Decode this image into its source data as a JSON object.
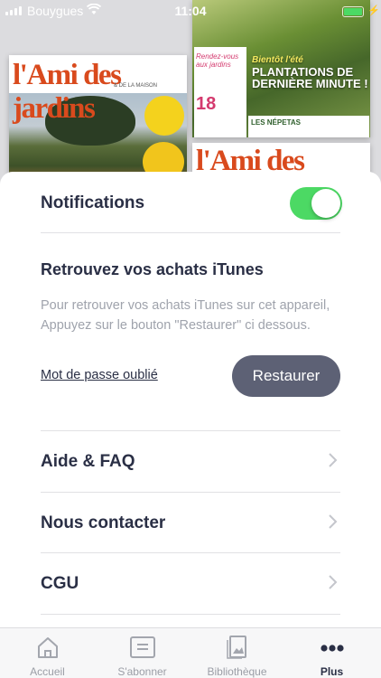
{
  "status_bar": {
    "carrier": "Bouygues",
    "time": "11:04"
  },
  "covers": {
    "left": {
      "masthead": "l'Ami des jardins",
      "masthead_sub": "& DE LA MAISON"
    },
    "right": {
      "inset_title": "Rendez-vous aux jardins",
      "big_number": "18",
      "headline_top": "Bientôt l'été",
      "headline": "PLANTATIONS DE DERNIÈRE MINUTE !",
      "box_title": "LES NÉPETAS"
    },
    "bottom": {
      "masthead": "l'Ami des jardins"
    }
  },
  "settings": {
    "notifications_label": "Notifications",
    "notifications_enabled": true,
    "itunes_title": "Retrouvez vos achats iTunes",
    "itunes_description": "Pour retrouver vos achats iTunes sur cet appareil, Appuyez sur le bouton \"Restaurer\" ci dessous.",
    "forgot_password": "Mot de passe oublié",
    "restore_button": "Restaurer"
  },
  "menu": [
    {
      "label": "Aide & FAQ"
    },
    {
      "label": "Nous contacter"
    },
    {
      "label": "CGU"
    }
  ],
  "tabbar": {
    "items": [
      {
        "label": "Accueil",
        "icon": "home-icon"
      },
      {
        "label": "S'abonner",
        "icon": "subscribe-icon"
      },
      {
        "label": "Bibliothèque",
        "icon": "library-icon"
      },
      {
        "label": "Plus",
        "icon": "more-icon"
      }
    ],
    "active": "Plus"
  },
  "colors": {
    "toggle_on": "#4cd964",
    "primary_text": "#2a2f45",
    "secondary_text": "#9fa3ac",
    "button_bg": "#5d6175"
  }
}
